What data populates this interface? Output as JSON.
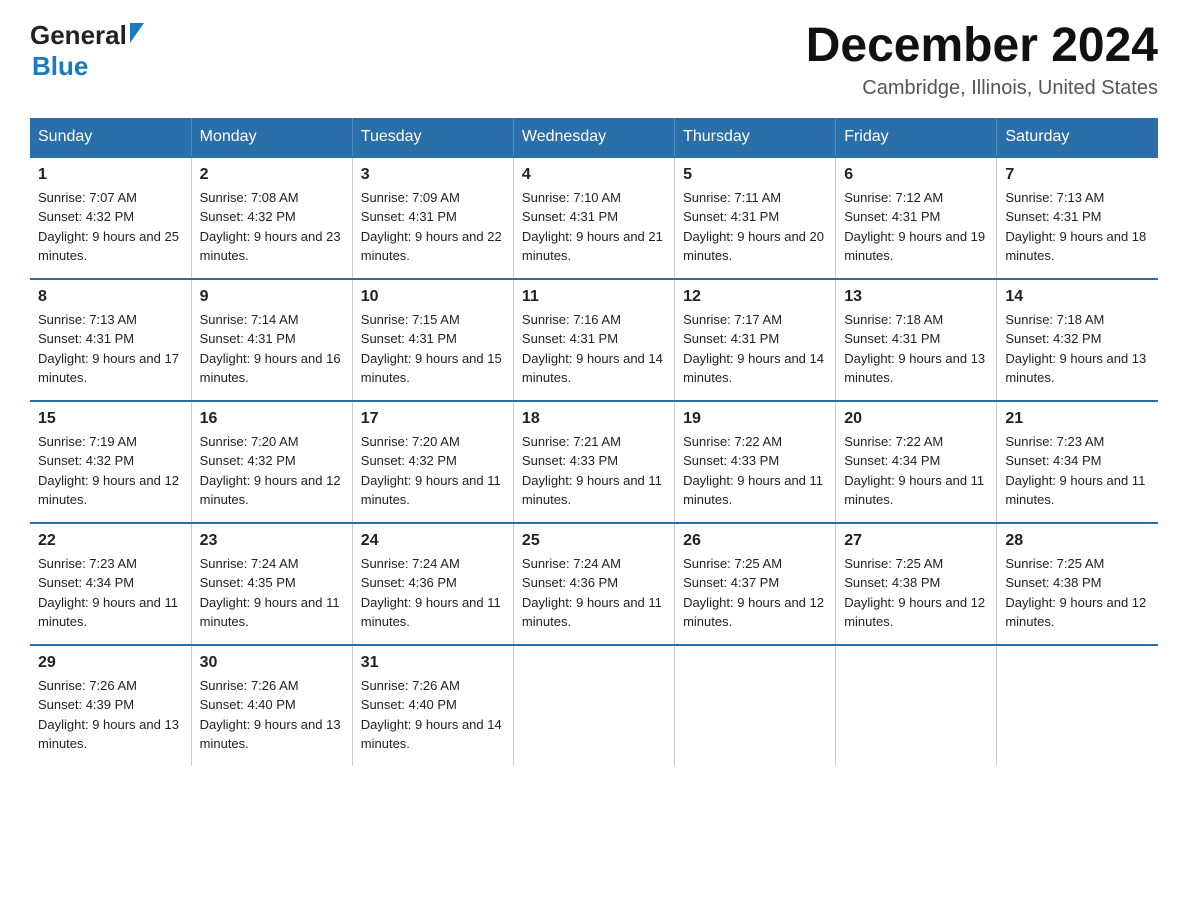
{
  "header": {
    "logo_general": "General",
    "logo_blue": "Blue",
    "month_title": "December 2024",
    "location": "Cambridge, Illinois, United States"
  },
  "weekdays": [
    "Sunday",
    "Monday",
    "Tuesday",
    "Wednesday",
    "Thursday",
    "Friday",
    "Saturday"
  ],
  "weeks": [
    [
      {
        "day": "1",
        "sunrise": "7:07 AM",
        "sunset": "4:32 PM",
        "daylight": "9 hours and 25 minutes."
      },
      {
        "day": "2",
        "sunrise": "7:08 AM",
        "sunset": "4:32 PM",
        "daylight": "9 hours and 23 minutes."
      },
      {
        "day": "3",
        "sunrise": "7:09 AM",
        "sunset": "4:31 PM",
        "daylight": "9 hours and 22 minutes."
      },
      {
        "day": "4",
        "sunrise": "7:10 AM",
        "sunset": "4:31 PM",
        "daylight": "9 hours and 21 minutes."
      },
      {
        "day": "5",
        "sunrise": "7:11 AM",
        "sunset": "4:31 PM",
        "daylight": "9 hours and 20 minutes."
      },
      {
        "day": "6",
        "sunrise": "7:12 AM",
        "sunset": "4:31 PM",
        "daylight": "9 hours and 19 minutes."
      },
      {
        "day": "7",
        "sunrise": "7:13 AM",
        "sunset": "4:31 PM",
        "daylight": "9 hours and 18 minutes."
      }
    ],
    [
      {
        "day": "8",
        "sunrise": "7:13 AM",
        "sunset": "4:31 PM",
        "daylight": "9 hours and 17 minutes."
      },
      {
        "day": "9",
        "sunrise": "7:14 AM",
        "sunset": "4:31 PM",
        "daylight": "9 hours and 16 minutes."
      },
      {
        "day": "10",
        "sunrise": "7:15 AM",
        "sunset": "4:31 PM",
        "daylight": "9 hours and 15 minutes."
      },
      {
        "day": "11",
        "sunrise": "7:16 AM",
        "sunset": "4:31 PM",
        "daylight": "9 hours and 14 minutes."
      },
      {
        "day": "12",
        "sunrise": "7:17 AM",
        "sunset": "4:31 PM",
        "daylight": "9 hours and 14 minutes."
      },
      {
        "day": "13",
        "sunrise": "7:18 AM",
        "sunset": "4:31 PM",
        "daylight": "9 hours and 13 minutes."
      },
      {
        "day": "14",
        "sunrise": "7:18 AM",
        "sunset": "4:32 PM",
        "daylight": "9 hours and 13 minutes."
      }
    ],
    [
      {
        "day": "15",
        "sunrise": "7:19 AM",
        "sunset": "4:32 PM",
        "daylight": "9 hours and 12 minutes."
      },
      {
        "day": "16",
        "sunrise": "7:20 AM",
        "sunset": "4:32 PM",
        "daylight": "9 hours and 12 minutes."
      },
      {
        "day": "17",
        "sunrise": "7:20 AM",
        "sunset": "4:32 PM",
        "daylight": "9 hours and 11 minutes."
      },
      {
        "day": "18",
        "sunrise": "7:21 AM",
        "sunset": "4:33 PM",
        "daylight": "9 hours and 11 minutes."
      },
      {
        "day": "19",
        "sunrise": "7:22 AM",
        "sunset": "4:33 PM",
        "daylight": "9 hours and 11 minutes."
      },
      {
        "day": "20",
        "sunrise": "7:22 AM",
        "sunset": "4:34 PM",
        "daylight": "9 hours and 11 minutes."
      },
      {
        "day": "21",
        "sunrise": "7:23 AM",
        "sunset": "4:34 PM",
        "daylight": "9 hours and 11 minutes."
      }
    ],
    [
      {
        "day": "22",
        "sunrise": "7:23 AM",
        "sunset": "4:34 PM",
        "daylight": "9 hours and 11 minutes."
      },
      {
        "day": "23",
        "sunrise": "7:24 AM",
        "sunset": "4:35 PM",
        "daylight": "9 hours and 11 minutes."
      },
      {
        "day": "24",
        "sunrise": "7:24 AM",
        "sunset": "4:36 PM",
        "daylight": "9 hours and 11 minutes."
      },
      {
        "day": "25",
        "sunrise": "7:24 AM",
        "sunset": "4:36 PM",
        "daylight": "9 hours and 11 minutes."
      },
      {
        "day": "26",
        "sunrise": "7:25 AM",
        "sunset": "4:37 PM",
        "daylight": "9 hours and 12 minutes."
      },
      {
        "day": "27",
        "sunrise": "7:25 AM",
        "sunset": "4:38 PM",
        "daylight": "9 hours and 12 minutes."
      },
      {
        "day": "28",
        "sunrise": "7:25 AM",
        "sunset": "4:38 PM",
        "daylight": "9 hours and 12 minutes."
      }
    ],
    [
      {
        "day": "29",
        "sunrise": "7:26 AM",
        "sunset": "4:39 PM",
        "daylight": "9 hours and 13 minutes."
      },
      {
        "day": "30",
        "sunrise": "7:26 AM",
        "sunset": "4:40 PM",
        "daylight": "9 hours and 13 minutes."
      },
      {
        "day": "31",
        "sunrise": "7:26 AM",
        "sunset": "4:40 PM",
        "daylight": "9 hours and 14 minutes."
      },
      {
        "day": "",
        "sunrise": "",
        "sunset": "",
        "daylight": ""
      },
      {
        "day": "",
        "sunrise": "",
        "sunset": "",
        "daylight": ""
      },
      {
        "day": "",
        "sunrise": "",
        "sunset": "",
        "daylight": ""
      },
      {
        "day": "",
        "sunrise": "",
        "sunset": "",
        "daylight": ""
      }
    ]
  ],
  "labels": {
    "sunrise_prefix": "Sunrise: ",
    "sunset_prefix": "Sunset: ",
    "daylight_prefix": "Daylight: "
  }
}
